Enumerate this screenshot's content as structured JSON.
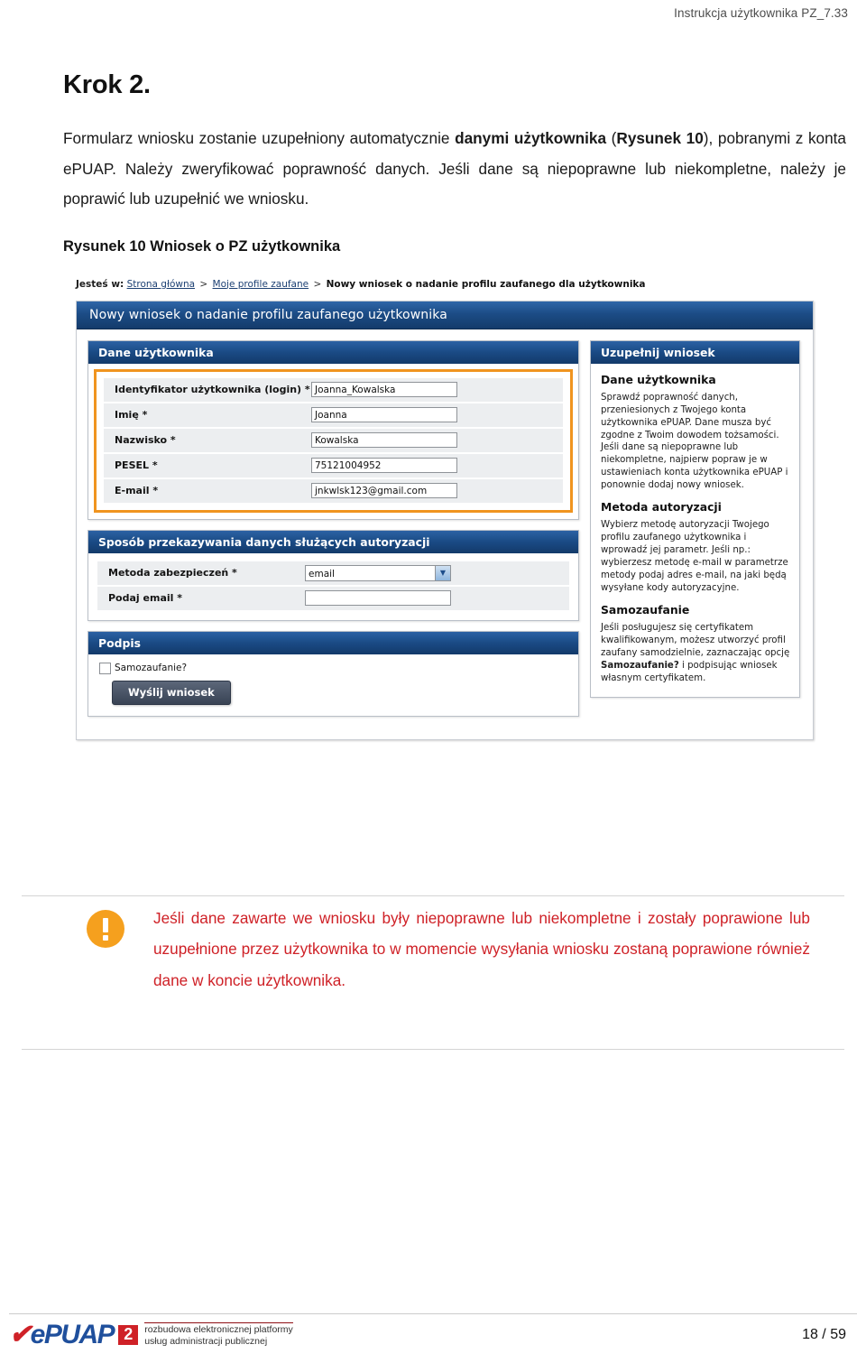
{
  "document": {
    "running_header": "Instrukcja użytkownika PZ_7.33",
    "page_title": "Krok 2.",
    "paragraph_part1": "Formularz wniosku zostanie uzupełniony automatycznie ",
    "paragraph_bold1": "danymi użytkownika",
    "paragraph_part2": " (",
    "paragraph_bold2": "Rysunek 10",
    "paragraph_part3": "), pobranymi z konta ePUAP. Należy zweryfikować poprawność danych. Jeśli dane są niepoprawne lub niekompletne, należy je poprawić lub uzupełnić we wniosku.",
    "figure_caption": "Rysunek 10 Wniosek o PZ użytkownika"
  },
  "screenshot": {
    "breadcrumb": {
      "lead": "Jesteś w:",
      "link1": "Strona główna",
      "sep": ">",
      "link2": "Moje profile zaufane",
      "current": "Nowy wniosek o nadanie profilu zaufanego dla użytkownika"
    },
    "panel_title": "Nowy wniosek o nadanie profilu zaufanego użytkownika",
    "section_user_data": {
      "header": "Dane użytkownika",
      "fields": [
        {
          "label": "Identyfikator użytkownika (login) *",
          "value": "Joanna_Kowalska"
        },
        {
          "label": "Imię *",
          "value": "Joanna"
        },
        {
          "label": "Nazwisko *",
          "value": "Kowalska"
        },
        {
          "label": "PESEL *",
          "value": "75121004952"
        },
        {
          "label": "E-mail *",
          "value": "jnkwlsk123@gmail.com"
        }
      ]
    },
    "section_auth": {
      "header": "Sposób przekazywania danych służących autoryzacji",
      "method_label": "Metoda zabezpieczeń *",
      "method_value": "email",
      "email_label": "Podaj email *",
      "email_value": ""
    },
    "section_signature": {
      "header": "Podpis",
      "checkbox_label": "Samozaufanie?",
      "submit_label": "Wyślij wniosek"
    },
    "help_panel": {
      "header": "Uzupełnij wniosek",
      "h1": "Dane użytkownika",
      "p1": "Sprawdź poprawność danych, przeniesionych z Twojego konta użytkownika ePUAP. Dane musza być zgodne z Twoim dowodem tożsamości. Jeśli dane są niepoprawne lub niekompletne, najpierw popraw je w ustawieniach konta użytkownika ePUAP i ponownie dodaj nowy wniosek.",
      "h2": "Metoda autoryzacji",
      "p2": "Wybierz metodę autoryzacji Twojego profilu zaufanego użytkownika i wprowadź jej parametr. Jeśli np.: wybierzesz metodę e-mail w parametrze metody podaj adres e-mail, na jaki będą wysyłane kody autoryzacyjne.",
      "h3": "Samozaufanie",
      "p3_a": "Jeśli posługujesz się certyfikatem kwalifikowanym, możesz utworzyć profil zaufany samodzielnie, zaznaczając opcję ",
      "p3_bold": "Samozaufanie?",
      "p3_b": " i podpisując wniosek własnym certyfikatem."
    }
  },
  "callout": {
    "icon": "warning-exclamation-icon",
    "color": "#cf2127",
    "icon_color": "#f5a01e",
    "text": "Jeśli dane zawarte we wniosku były niepoprawne lub niekompletne i zostały poprawione lub uzupełnione przez użytkownika to w momencie wysyłania wniosku zostaną poprawione również dane w koncie użytkownika."
  },
  "footer": {
    "logo_check": "✔",
    "logo_text": "ePUAP",
    "logo_badge": "2",
    "logo_sub_line1": "rozbudowa elektronicznej platformy",
    "logo_sub_line2": "usług administracji publicznej",
    "page_number": "18 / 59"
  }
}
